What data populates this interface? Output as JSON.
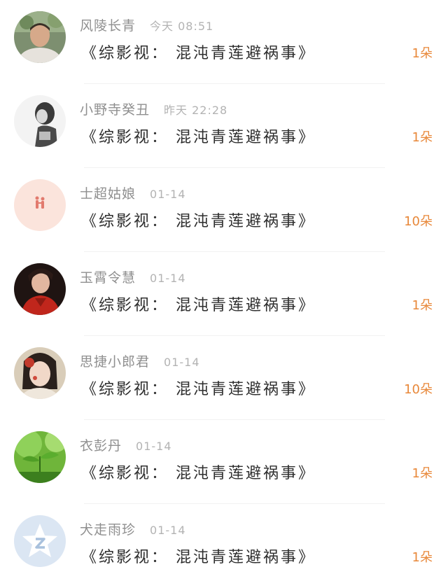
{
  "items": [
    {
      "name": "风陵长青",
      "time": "今天 08:51",
      "title": "《综影视： 混沌青莲避祸事》",
      "count": "1朵",
      "avatar": "man-photo"
    },
    {
      "name": "小野寺癸丑",
      "time": "昨天 22:28",
      "title": "《综影视： 混沌青莲避祸事》",
      "count": "1朵",
      "avatar": "grayscale-portrait"
    },
    {
      "name": "士超姑娘",
      "time": "01-14",
      "title": "《综影视： 混沌青莲避祸事》",
      "count": "10朵",
      "avatar": "pink-couple-illustration"
    },
    {
      "name": "玉霄令慧",
      "time": "01-14",
      "title": "《综影视： 混沌青莲避祸事》",
      "count": "1朵",
      "avatar": "red-costume-portrait"
    },
    {
      "name": "思捷小郎君",
      "time": "01-14",
      "title": "《综影视： 混沌青莲避祸事》",
      "count": "10朵",
      "avatar": "girl-with-flower-portrait"
    },
    {
      "name": "衣彭丹",
      "time": "01-14",
      "title": "《综影视： 混沌青莲避祸事》",
      "count": "1朵",
      "avatar": "green-sprout-photo"
    },
    {
      "name": "犬走雨珍",
      "time": "01-14",
      "title": "《综影视： 混沌青莲避祸事》",
      "count": "1朵",
      "avatar": "default-star-avatar"
    }
  ],
  "colors": {
    "count_accent": "#e8883a",
    "name_text": "#8f8f8f",
    "time_text": "#b3b3b3",
    "title_text": "#2e2e2e"
  }
}
